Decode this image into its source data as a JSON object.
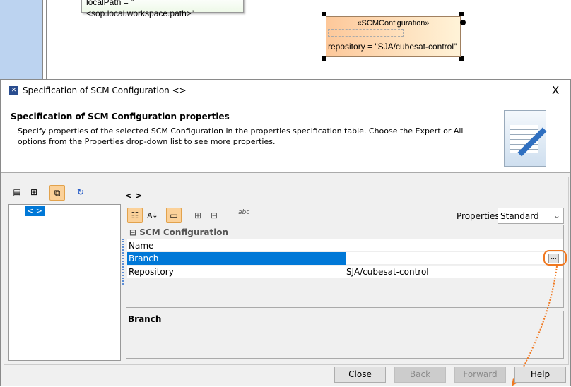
{
  "diagram": {
    "note_text": "localPath = \"<sop.local.workspace.path>\"",
    "class_stereotype": "«SCMConfiguration»",
    "class_attribute": "repository = \"SJA/cubesat-control\""
  },
  "dialog": {
    "title": "Specification of SCM Configuration <>",
    "close_glyph": "X",
    "header": {
      "title": "Specification of SCM Configuration properties",
      "description": "Specify properties of the selected SCM Configuration in the properties specification table. Choose the Expert or All options from the Properties drop-down list to see more properties."
    },
    "tree": {
      "item_label": "< >"
    },
    "element_label": "< >",
    "toolbar": {
      "abc_label": "abc"
    },
    "properties_label": "Properties:",
    "properties_value": "Standard",
    "table": {
      "group": "SCM Configuration",
      "rows": [
        {
          "name": "Name",
          "value": ""
        },
        {
          "name": "Branch",
          "value": ""
        },
        {
          "name": "Repository",
          "value": "SJA/cubesat-control"
        }
      ],
      "ellipsis": "..."
    },
    "description_title": "Branch",
    "buttons": {
      "close": "Close",
      "back": "Back",
      "forward": "Forward",
      "help": "Help"
    },
    "accent": "#0078d7",
    "callout": "#f07820"
  }
}
